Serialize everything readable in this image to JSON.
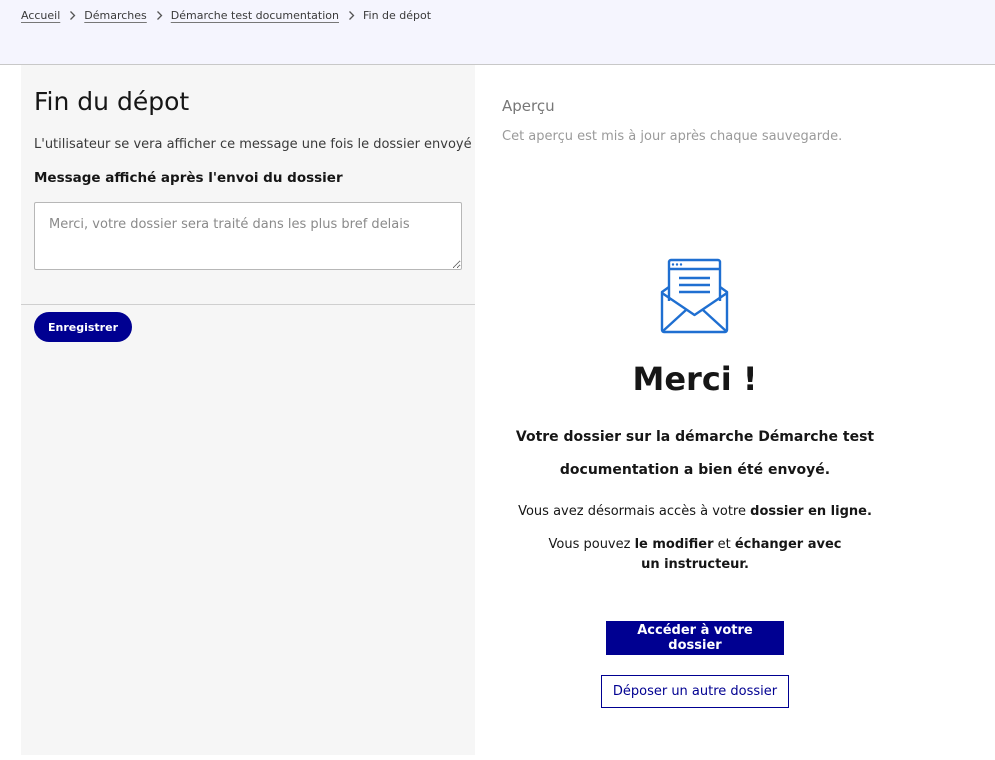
{
  "breadcrumb": {
    "items": [
      "Accueil",
      "Démarches",
      "Démarche test documentation"
    ],
    "current": "Fin de dépot"
  },
  "editor": {
    "title": "Fin du dépot",
    "hint": "L'utilisateur se vera afficher ce message une fois le dossier envoyé",
    "field_label": "Message affiché après l'envoi du dossier",
    "message_placeholder": "Merci, votre dossier sera traité dans les plus bref delais",
    "message_value": "",
    "save_label": "Enregistrer"
  },
  "preview": {
    "title": "Aperçu",
    "subtitle": "Cet aperçu est mis à jour après chaque sauvegarde.",
    "icon": "envelope-mail-icon",
    "heading": "Merci !",
    "confirmation_line1": "Votre dossier sur la démarche Démarche test",
    "confirmation_line2": "documentation a bien été envoyé.",
    "access": {
      "prefix": "Vous avez désormais accès à votre ",
      "strong": "dossier en ligne",
      "suffix": "."
    },
    "actions_text": {
      "prefix": "Vous pouvez ",
      "strong1": "le modifier",
      "middle": " et ",
      "strong2": "échanger avec un instructeur",
      "suffix": "."
    },
    "primary_button": "Accéder à votre dossier",
    "secondary_button": "Déposer un autre dossier"
  },
  "colors": {
    "primary": "#000091",
    "header_bg": "#f5f5fe",
    "panel_bg": "#f6f6f6",
    "icon_blue": "#1f6fd1"
  }
}
